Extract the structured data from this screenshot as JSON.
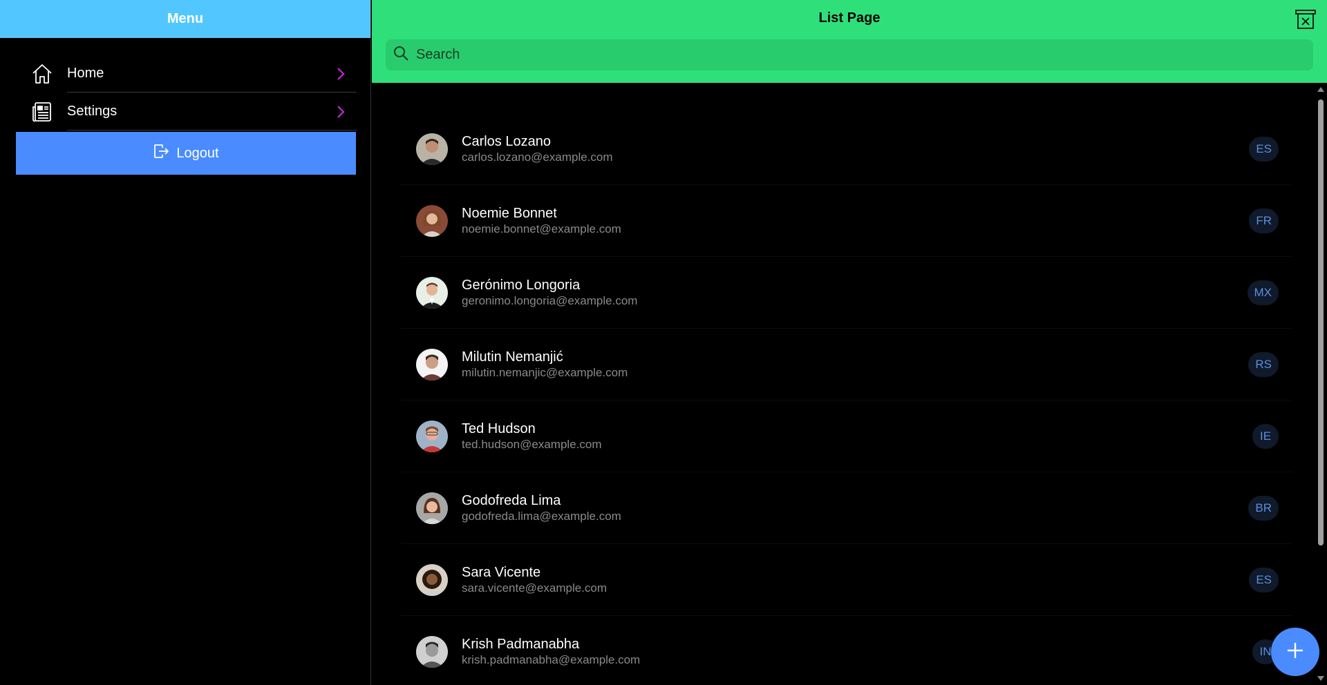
{
  "sidebar": {
    "title": "Menu",
    "items": [
      {
        "label": "Home",
        "icon": "home-icon"
      },
      {
        "label": "Settings",
        "icon": "newspaper-icon"
      }
    ],
    "logout_label": "Logout"
  },
  "main": {
    "title": "List Page",
    "search_placeholder": "Search",
    "people": [
      {
        "name": "Carlos Lozano",
        "email": "carlos.lozano@example.com",
        "country": "ES"
      },
      {
        "name": "Noemie Bonnet",
        "email": "noemie.bonnet@example.com",
        "country": "FR"
      },
      {
        "name": "Gerónimo Longoria",
        "email": "geronimo.longoria@example.com",
        "country": "MX"
      },
      {
        "name": "Milutin Nemanjić",
        "email": "milutin.nemanjic@example.com",
        "country": "RS"
      },
      {
        "name": "Ted Hudson",
        "email": "ted.hudson@example.com",
        "country": "IE"
      },
      {
        "name": "Godofreda Lima",
        "email": "godofreda.lima@example.com",
        "country": "BR"
      },
      {
        "name": "Sara Vicente",
        "email": "sara.vicente@example.com",
        "country": "ES"
      },
      {
        "name": "Krish Padmanabha",
        "email": "krish.padmanabha@example.com",
        "country": "IN"
      }
    ]
  },
  "colors": {
    "sidebar_header": "#52c7ff",
    "topbar": "#2fe07a",
    "logout_button": "#4a8cff",
    "chevron": "#c02ad0",
    "badge_text": "#5a8fe0"
  }
}
